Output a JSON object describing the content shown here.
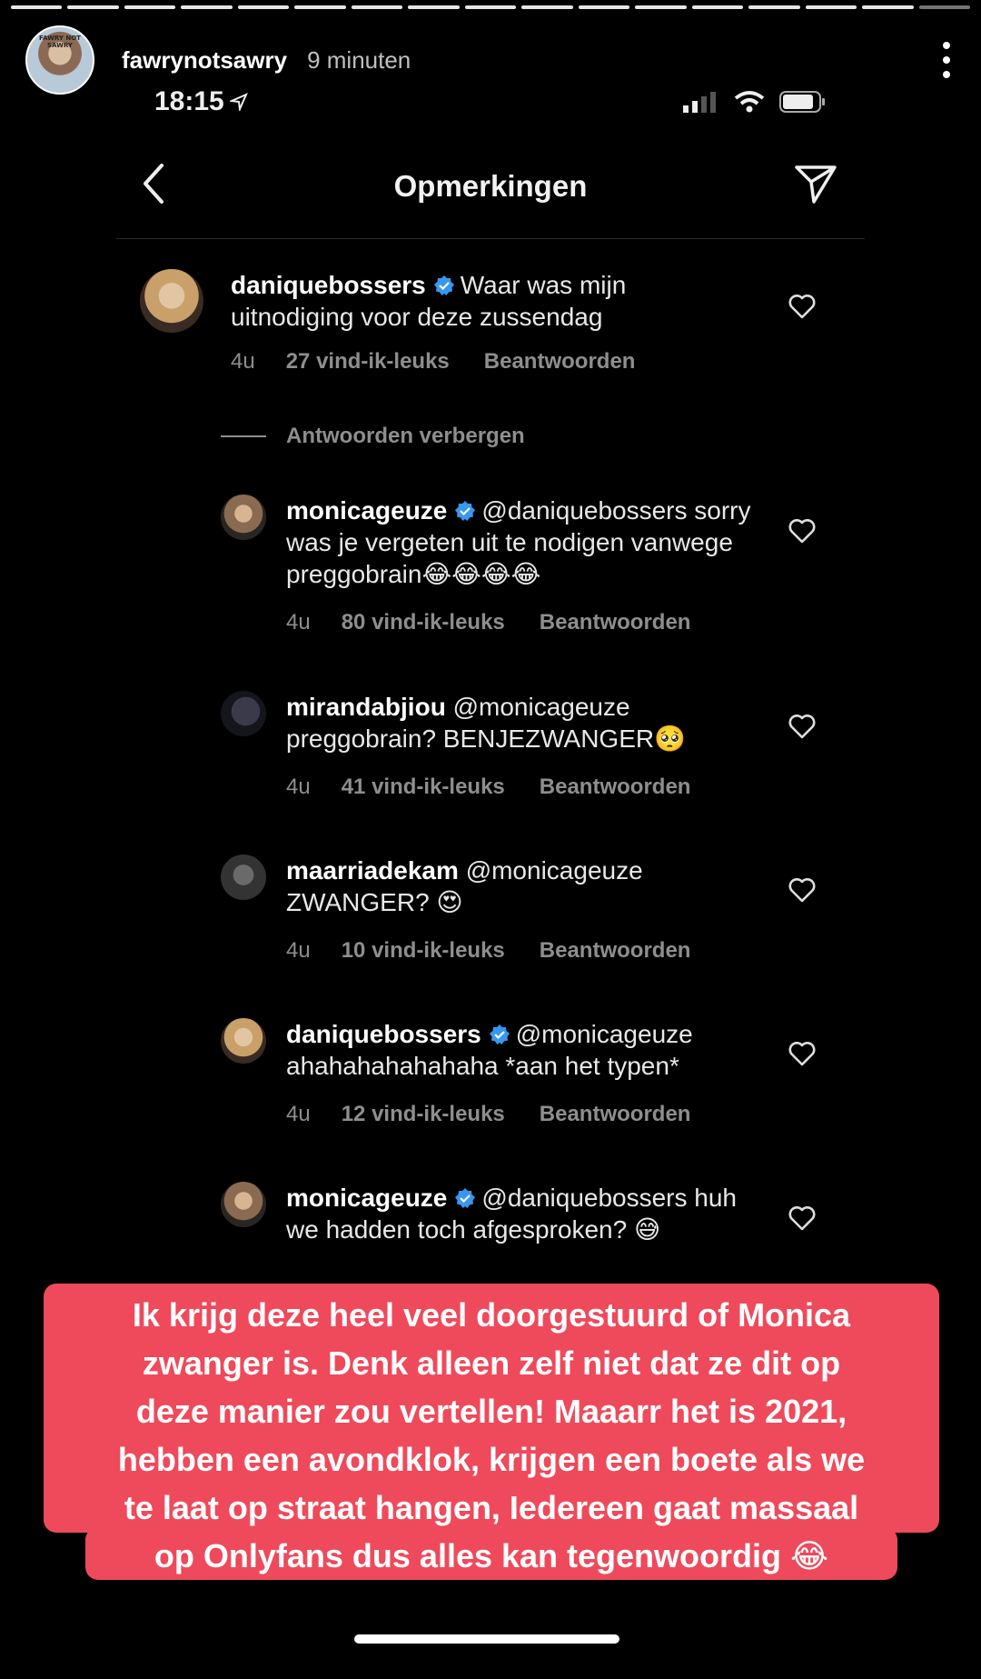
{
  "story": {
    "username": "fawrynotsawry",
    "time_ago": "9 minuten",
    "avatar_text": "FAWRY NOT SAWRY",
    "progress_segments": 17,
    "active_segment": 17
  },
  "status_bar": {
    "time": "18:15"
  },
  "nav": {
    "title": "Opmerkingen",
    "back_icon": "chevron-left-icon",
    "send_icon": "send-icon"
  },
  "comments": [
    {
      "user": "daniquebossers",
      "verified": true,
      "text": "Waar was mijn uitnodiging voor deze zussendag",
      "time": "4u",
      "likes": "27 vind-ik-leuks",
      "reply": "Beantwoorden"
    }
  ],
  "hide_replies": "Antwoorden verbergen",
  "replies": [
    {
      "user": "monicageuze",
      "verified": true,
      "text": "@daniquebossers sorry was je vergeten uit te nodigen vanwege preggobrain😂😂😂😂",
      "time": "4u",
      "likes": "80 vind-ik-leuks",
      "reply": "Beantwoorden"
    },
    {
      "user": "mirandabjiou",
      "verified": false,
      "text": "@monicageuze preggobrain? BENJEZWANGER🥺",
      "time": "4u",
      "likes": "41 vind-ik-leuks",
      "reply": "Beantwoorden"
    },
    {
      "user": "maarriadekam",
      "verified": false,
      "text": "@monicageuze ZWANGER? 😍",
      "time": "4u",
      "likes": "10 vind-ik-leuks",
      "reply": "Beantwoorden"
    },
    {
      "user": "daniquebossers",
      "verified": true,
      "text": "@monicageuze ahahahahahahaha *aan het typen*",
      "time": "4u",
      "likes": "12 vind-ik-leuks",
      "reply": "Beantwoorden"
    },
    {
      "user": "monicageuze",
      "verified": true,
      "text": "@daniquebossers huh we hadden toch afgesproken? 😅"
    }
  ],
  "caption": {
    "lines": [
      "Ik krijg deze heel veel doorgestuurd of Monica",
      "zwanger is. Denk alleen zelf niet dat ze dit op",
      "deze manier zou vertellen! Maaarr het is 2021,",
      "hebben een avondklok, krijgen een boete als we",
      "te laat op straat hangen, Iedereen gaat massaal",
      "op Onlyfans dus alles kan tegenwoordig 😂"
    ],
    "background_color": "#ee4a5b"
  }
}
